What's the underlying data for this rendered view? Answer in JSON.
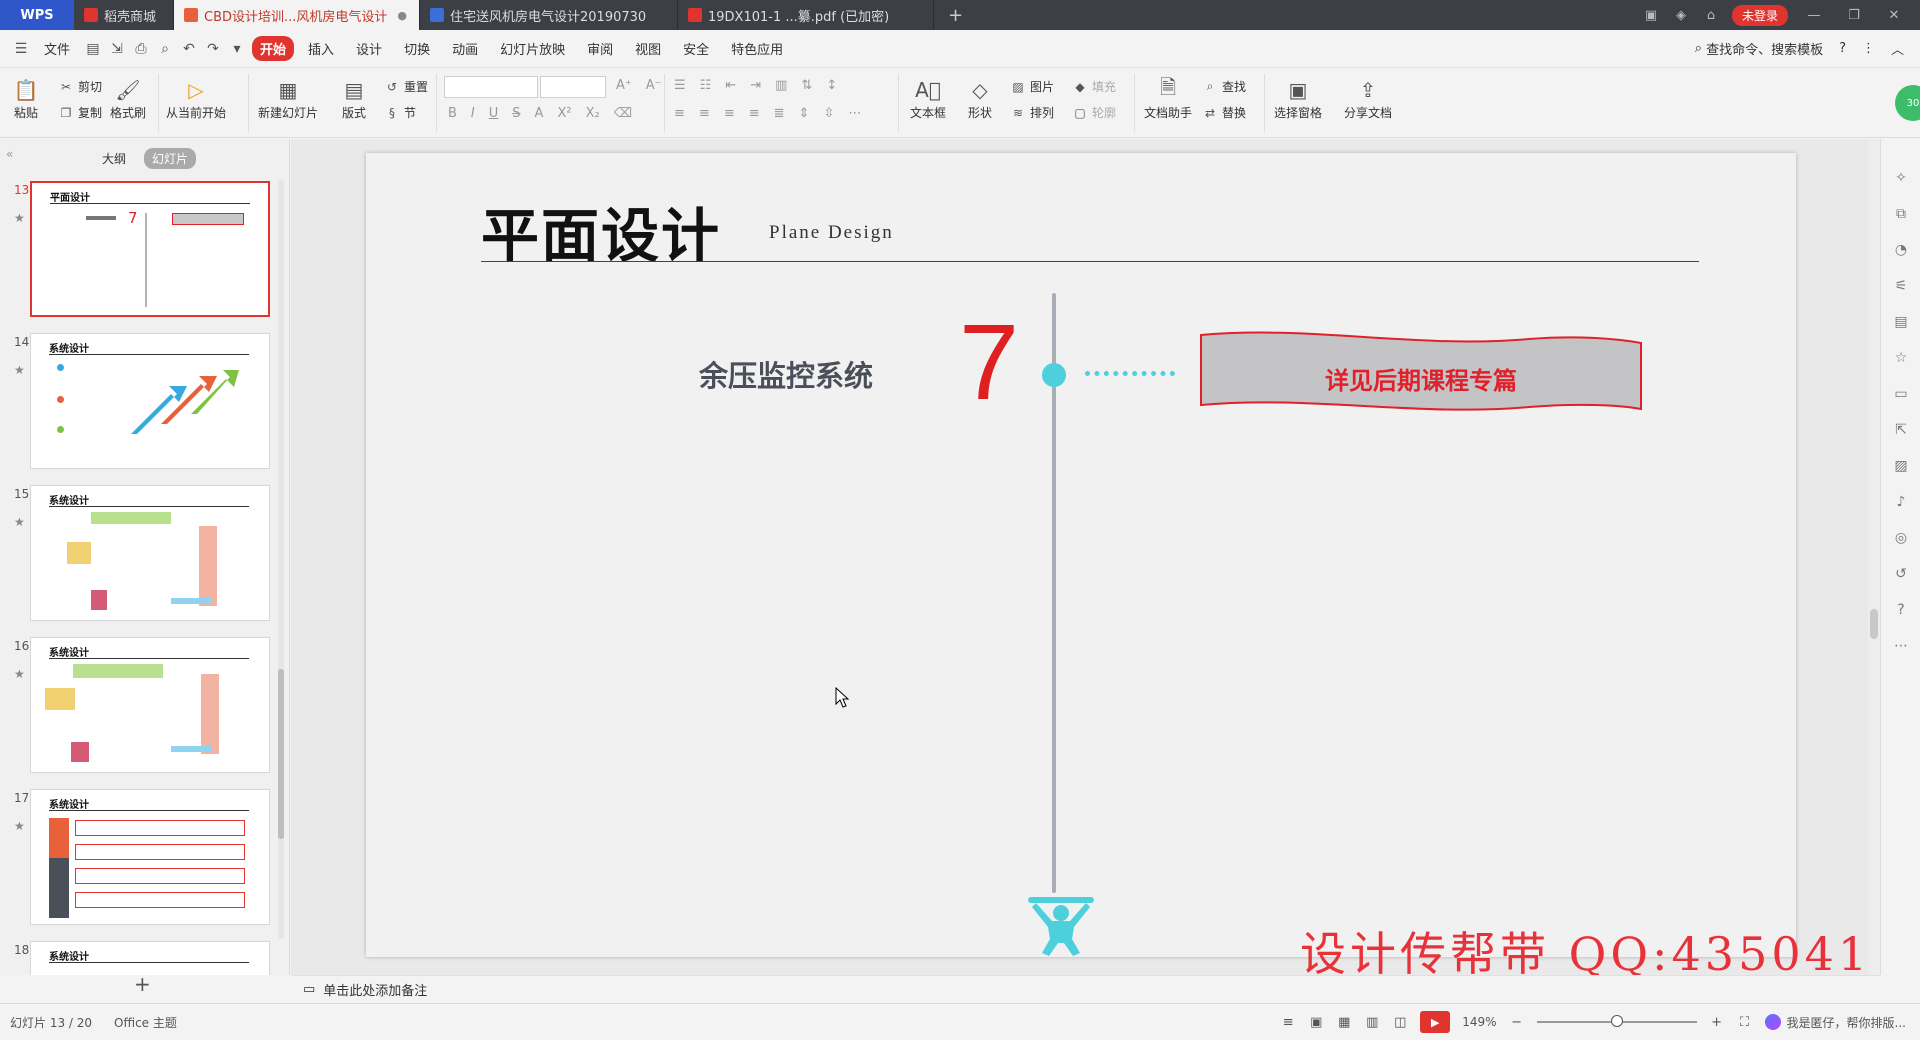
{
  "titlebar": {
    "app_name": "WPS",
    "tabs": [
      {
        "label": "稻壳商城",
        "icon": "daoke-icon",
        "color": "#e0342f"
      },
      {
        "label": "CBD设计培训...风机房电气设计",
        "icon": "ppt-icon",
        "color": "#e8613a"
      },
      {
        "label": "住宅送风机房电气设计20190730",
        "icon": "word-icon",
        "color": "#3b6fd8"
      },
      {
        "label": "19DX101-1 ...纂.pdf (已加密)",
        "icon": "pdf-icon",
        "color": "#e0342f"
      }
    ],
    "login_label": "未登录"
  },
  "menubar": {
    "file_label": "文件",
    "items": [
      "开始",
      "插入",
      "设计",
      "切换",
      "动画",
      "幻灯片放映",
      "审阅",
      "视图",
      "安全",
      "特色应用"
    ],
    "active": "开始",
    "search_label": "查找命令、搜索模板"
  },
  "ribbon": {
    "paste": "粘贴",
    "cut": "剪切",
    "copy": "复制",
    "format_painter": "格式刷",
    "from_current": "从当前开始",
    "new_slide": "新建幻灯片",
    "layout": "版式",
    "reset": "重置",
    "section": "节",
    "textbox": "文本框",
    "shape": "形状",
    "picture": "图片",
    "fill": "填充",
    "arrange": "排列",
    "outline": "轮廓",
    "doc_assistant": "文档助手",
    "find": "查找",
    "replace": "替换",
    "selection_pane": "选择窗格",
    "share_doc": "分享文档"
  },
  "leftpanel": {
    "tab_outline": "大纲",
    "tab_slides": "幻灯片",
    "thumbnails": [
      {
        "num": "13",
        "title": "平面设计",
        "selected": true
      },
      {
        "num": "14",
        "title": "系统设计",
        "selected": false
      },
      {
        "num": "15",
        "title": "系统设计",
        "selected": false
      },
      {
        "num": "16",
        "title": "系统设计",
        "selected": false
      },
      {
        "num": "17",
        "title": "系统设计",
        "selected": false
      },
      {
        "num": "18",
        "title": "系统设计",
        "selected": false
      }
    ],
    "thumb13_num": "7"
  },
  "slide": {
    "title": "平面设计",
    "subtitle": "Plane Design",
    "system_label": "余压监控系统",
    "number": "7",
    "banner_text": "详见后期课程专篇",
    "accent": "#4dd0dc",
    "red": "#e02020"
  },
  "watermark": "设计传帮带  QQ:435041",
  "notes_placeholder": "单击此处添加备注",
  "status": {
    "slide_info": "幻灯片 13 / 20",
    "theme": "Office 主题",
    "zoom": "149%",
    "assistant_text": "我是匿仔，帮你排版..."
  },
  "rightbar_badge": "30"
}
